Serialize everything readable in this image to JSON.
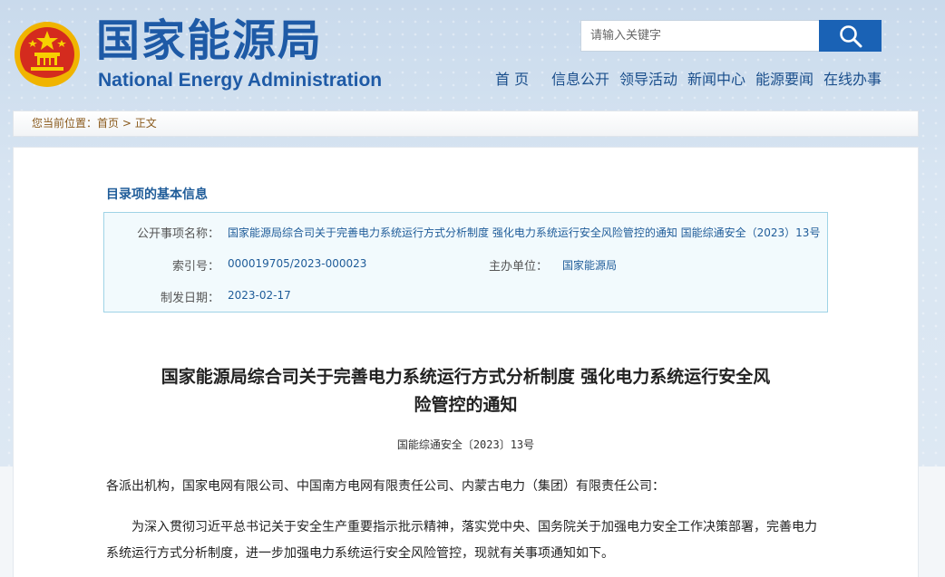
{
  "header": {
    "title_cn": "国家能源局",
    "title_en": "National Energy Administration",
    "search_placeholder": "请输入关键字",
    "brand_color": "#1e5aa6"
  },
  "nav": {
    "items": [
      "首 页",
      "信息公开",
      "领导活动",
      "新闻中心",
      "能源要闻",
      "在线办事"
    ]
  },
  "breadcrumb": {
    "prefix": "您当前位置：",
    "home": "首页",
    "separator": ">",
    "current": "正文"
  },
  "info": {
    "heading": "目录项的基本信息",
    "matter_label": "公开事项名称：",
    "matter_value": "国家能源局综合司关于完善电力系统运行方式分析制度 强化电力系统运行安全风险管控的通知 国能综通安全（2023）13号",
    "index_label": "索引号：",
    "index_value": "000019705/2023-000023",
    "host_label": "主办单位：",
    "host_value": "国家能源局",
    "date_label": "制发日期：",
    "date_value": "2023-02-17"
  },
  "document": {
    "title_line1": "国家能源局综合司关于完善电力系统运行方式分析制度 强化电力系统运行安全风",
    "title_line2": "险管控的通知",
    "number": "国能综通安全〔2023〕13号",
    "recipients": "各派出机构，国家电网有限公司、中国南方电网有限责任公司、内蒙古电力（集团）有限责任公司：",
    "body_line1": "为深入贯彻习近平总书记关于安全生产重要指示批示精神，落实党中央、国务院关于加强电力安全工作决策部署，完善电力",
    "body_line2": "系统运行方式分析制度，进一步加强电力系统运行安全风险管控，现就有关事项通知如下。"
  }
}
